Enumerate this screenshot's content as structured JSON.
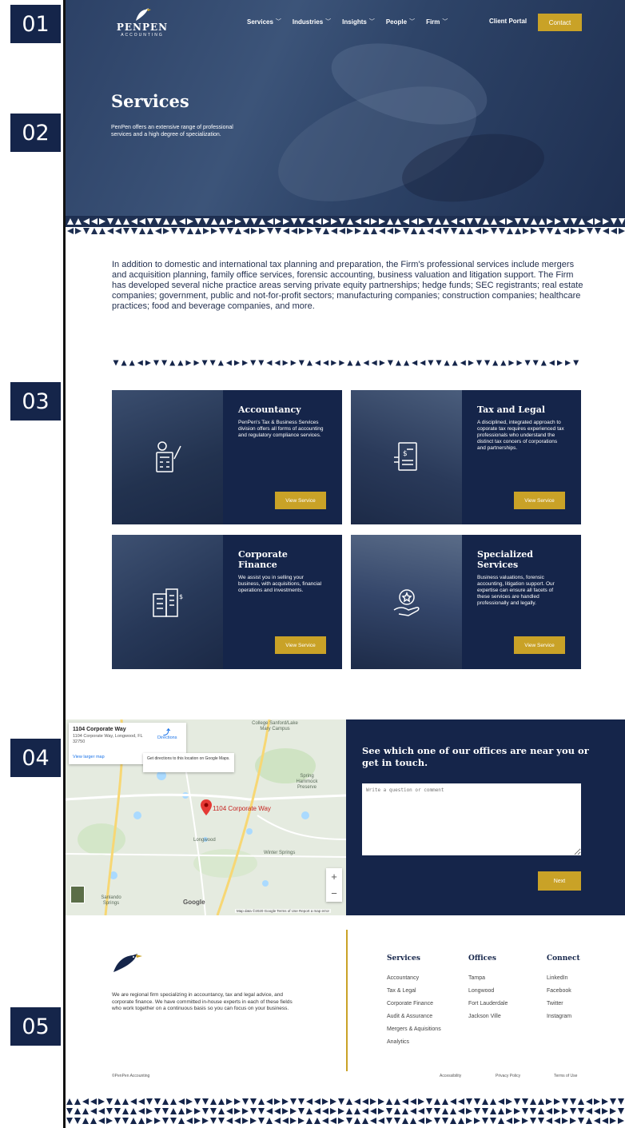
{
  "markers": [
    "01",
    "02",
    "03",
    "04",
    "05"
  ],
  "header": {
    "logo_name": "PENPEN",
    "logo_sub": "ACCOUNTING",
    "nav": [
      {
        "label": "Services"
      },
      {
        "label": "Industries"
      },
      {
        "label": "Insights"
      },
      {
        "label": "People"
      },
      {
        "label": "Firm"
      }
    ],
    "client_portal": "Client Portal",
    "contact": "Contact"
  },
  "hero": {
    "title": "Services",
    "description": "PenPen offers an extensive range of professional services and a high degree of specialization."
  },
  "intro": "In addition to domestic and international tax planning and preparation, the Firm's professional services include mergers and acquisition planning, family office services, forensic accounting, business valuation and litigation support. The Firm has developed several niche practice areas serving private equity partnerships; hedge funds; SEC registrants; real estate companies; government, public and not-for-profit sectors; manufacturing companies; construction companies; healthcare practices; food and beverage companies, and more.",
  "services": [
    {
      "title": "Accountancy",
      "description": "PenPen's Tax & Business Services division offers all forms of accounting and regulatory compliance services.",
      "button": "View Service",
      "icon": "calculator-chart-icon"
    },
    {
      "title": "Tax and Legal",
      "description": "A disciplined, integrated approach to coporate tax requires experienced tax professionals who understand the distinct tax concers of corporations and partnerships.",
      "button": "View Service",
      "icon": "tax-document-icon"
    },
    {
      "title": "Corporate Finance",
      "description": "We assist you in selling your business, with acquisitions, financial operations and investments.",
      "button": "View Service",
      "icon": "building-dollar-icon"
    },
    {
      "title": "Specialized Services",
      "description": "Business valuations, forensic accounting, litigation support. Our expertise can ensure all facets of these services are handled professionally and legally.",
      "button": "View Service",
      "icon": "hand-star-icon"
    }
  ],
  "map": {
    "place_title": "1104 Corporate Way",
    "place_address": "1104 Corporate Way, Longwood, FL 32750",
    "larger_map": "View larger map",
    "directions": "Directions",
    "tooltip": "Get directions to this location on Google Maps.",
    "pin_label": "1104 Corporate Way",
    "zoom_in": "+",
    "zoom_out": "−",
    "google": "Google",
    "footer": "Map data ©2020 Google   Terms of Use   Report a map error",
    "places": [
      {
        "name": "College Sanford/Lake Mary Campus"
      },
      {
        "name": "Spring Hammock Preserve"
      },
      {
        "name": "Longwood"
      },
      {
        "name": "Winter Springs"
      },
      {
        "name": "Sanlando Springs"
      }
    ]
  },
  "contact": {
    "title": "See which one of our offices are near you or get in touch.",
    "placeholder": "Write a question or comment",
    "next": "Next"
  },
  "footer": {
    "about": "We are regional firm specializing in accountancy, tax and legal advice, and corporate finance. We have committed in-house experts in each of these fields who work together on a continuous basis so you can focus on your business.",
    "columns": [
      {
        "title": "Services",
        "links": [
          "Accountancy",
          "Tax & Legal",
          "Corporate Finance",
          "Audit & Assurance",
          "Mergers & Aquisitions",
          "Analytics"
        ]
      },
      {
        "title": "Offices",
        "links": [
          "Tampa",
          "Longwood",
          "Fort Lauderdale",
          "Jackson Ville"
        ]
      },
      {
        "title": "Connect",
        "links": [
          "LinkedIn",
          "Facebook",
          "Twitter",
          "Instagram"
        ]
      }
    ],
    "copyright": "©PenPen Accounting",
    "legal": [
      "Accessibility",
      "Privacy Policy",
      "Terms of Use"
    ]
  },
  "colors": {
    "navy": "#15254a",
    "gold": "#c9a227",
    "hero": "#2c4166"
  }
}
